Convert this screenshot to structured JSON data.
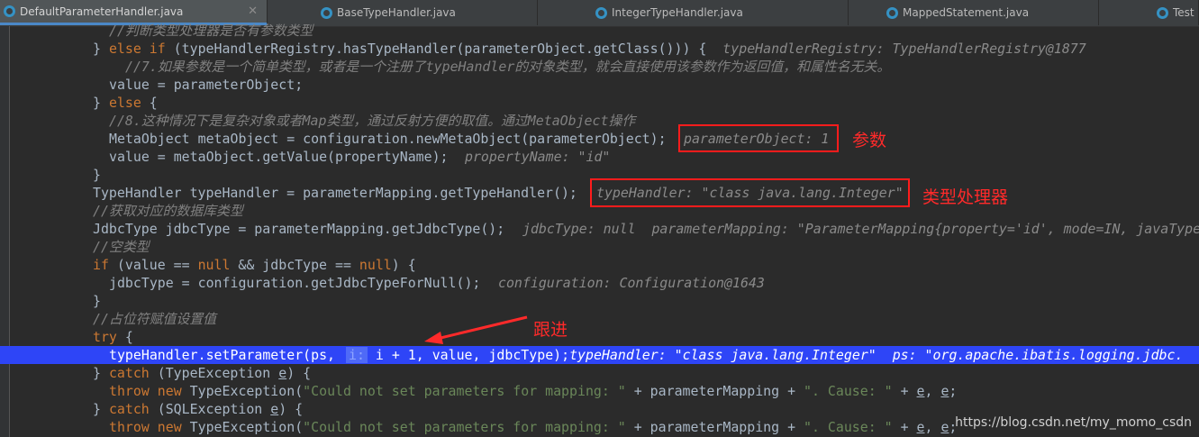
{
  "tabs": [
    {
      "label": "DefaultParameterHandler.java",
      "active": true
    },
    {
      "label": "BaseTypeHandler.java",
      "active": false
    },
    {
      "label": "IntegerTypeHandler.java",
      "active": false
    },
    {
      "label": "MappedStatement.java",
      "active": false
    },
    {
      "label": "Test",
      "active": false
    }
  ],
  "code": {
    "l0": "//判断类型处理器是否有参数类型",
    "l1_a": "} ",
    "l1_b": "else if",
    "l1_c": " (typeHandlerRegistry.hasTypeHandler(parameterObject.getClass())) {  ",
    "l1_hint": "typeHandlerRegistry: TypeHandlerRegistry@1877",
    "l2": "//7.如果参数是一个简单类型，或者是一个注册了typeHandler的对象类型，就会直接使用该参数作为返回值，和属性名无关。",
    "l3": "value = parameterObject;",
    "l4_a": "} ",
    "l4_b": "else",
    "l4_c": " {",
    "l5": "//8.这种情况下是复杂对象或者Map类型，通过反射方便的取值。通过MetaObject操作",
    "l6": "MetaObject metaObject = configuration.newMetaObject(parameterObject);",
    "l6_hint": "parameterObject: 1",
    "l7": "value = metaObject.getValue(propertyName);",
    "l7_hint": "propertyName: \"id\"",
    "l8": "}",
    "l9": "TypeHandler typeHandler = parameterMapping.getTypeHandler();",
    "l9_hint": "typeHandler: \"class java.lang.Integer\"",
    "l10": "//获取对应的数据库类型",
    "l11": "JdbcType jdbcType = parameterMapping.getJdbcType();",
    "l11_hint": "jdbcType: null  parameterMapping: \"ParameterMapping{property='id', mode=IN, javaType",
    "l12": "//空类型",
    "l13_a": "if",
    "l13_b": " (value == ",
    "l13_c": "null",
    "l13_d": " && jdbcType == ",
    "l13_e": "null",
    "l13_f": ") {",
    "l14": "jdbcType = configuration.getJdbcTypeForNull();",
    "l14_hint": "configuration: Configuration@1643",
    "l15": "}",
    "l16": "//占位符赋值设置值",
    "l17_a": "try",
    "l17_b": " {",
    "l18": "typeHandler.setParameter(ps,",
    "l18_param": "i:",
    "l18_rest": " i + 1, value, jdbcType);",
    "l18_hint": "typeHandler: \"class java.lang.Integer\"  ps: \"org.apache.ibatis.logging.jdbc.",
    "l19_a": "} ",
    "l19_b": "catch",
    "l19_c": " (TypeException ",
    "l19_e": "e",
    "l19_f": ") {",
    "l20_a": "throw new",
    "l20_b": " TypeException(",
    "l20_str": "\"Could not set parameters for mapping: \"",
    "l20_c": " + parameterMapping + ",
    "l20_str2": "\". Cause: \"",
    "l20_d": " + ",
    "l20_e1": "e",
    "l20_sep": ", ",
    "l20_e2": "e",
    "l20_end": ";",
    "l21_a": "} ",
    "l21_b": "catch",
    "l21_c": " (SQLException ",
    "l21_e": "e",
    "l21_f": ") {",
    "l22_a": "throw new",
    "l22_b": " TypeException(",
    "l22_str": "\"Could not set parameters for mapping: \"",
    "l22_c": " + parameterMapping + ",
    "l22_str2": "\". Cause: \"",
    "l22_d": " + ",
    "l22_e1": "e",
    "l22_sep": ", ",
    "l22_e2": "e",
    "l22_end": ";"
  },
  "annotations": {
    "param": "参数",
    "typehandler": "类型处理器",
    "follow": "跟进"
  },
  "watermark": "https://blog.csdn.net/my_momo_csdn"
}
